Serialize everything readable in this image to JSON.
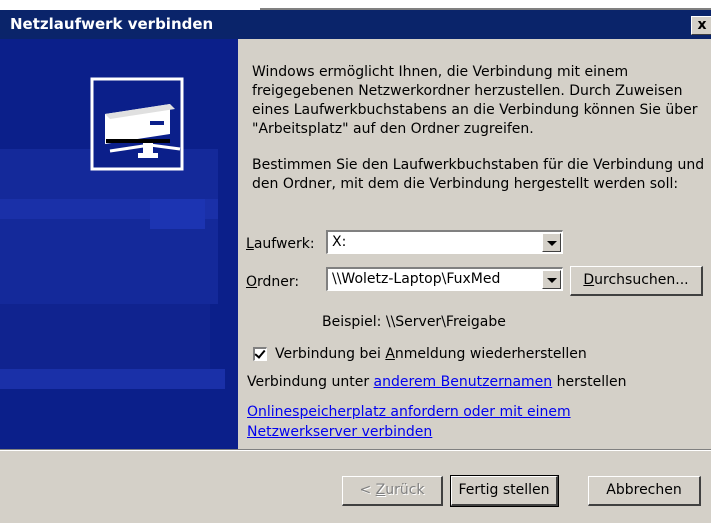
{
  "window": {
    "title": "Netzlaufwerk verbinden",
    "close_glyph": "x"
  },
  "intro_text": "Windows ermöglicht Ihnen, die Verbindung mit einem freigegebenen Netzwerkordner herzustellen. Durch Zuweisen eines Laufwerkbuchstabens an die Verbindung können Sie über \"Arbeitsplatz\" auf den Ordner zugreifen.",
  "instruction_text": "Bestimmen Sie den Laufwerkbuchstaben für die Verbindung und den Ordner, mit dem die Verbindung hergestellt werden soll:",
  "drive": {
    "label_underlined": "L",
    "label_rest": "aufwerk:",
    "value": "X:"
  },
  "folder": {
    "label_underlined": "O",
    "label_rest": "rdner:",
    "value": "\\\\Woletz-Laptop\\FuxMed",
    "browse_underlined": "D",
    "browse_rest": "urchsuchen..."
  },
  "example_text": "Beispiel: \\\\Server\\Freigabe",
  "reconnect": {
    "label_before": "Verbindung bei ",
    "label_underlined": "A",
    "label_after": "nmeldung wiederherstellen",
    "checked": true
  },
  "other_user": {
    "before": "Verbindung unter ",
    "link": "anderem Benutzernamen",
    "after": " herstellen"
  },
  "online_link": {
    "line1": "Onlinespeicherplatz anfordern oder mit einem ",
    "line2": "Netzwerkserver verbinden"
  },
  "buttons": {
    "back_prefix": "< ",
    "back_underlined": "Z",
    "back_rest": "urück",
    "finish": "Fertig stellen",
    "cancel": "Abbrechen"
  },
  "colors": {
    "titlebar": "#0a246a",
    "left_panel": "#0b1f8a",
    "dialog_face": "#d4d0c8",
    "link": "#0000ee"
  }
}
